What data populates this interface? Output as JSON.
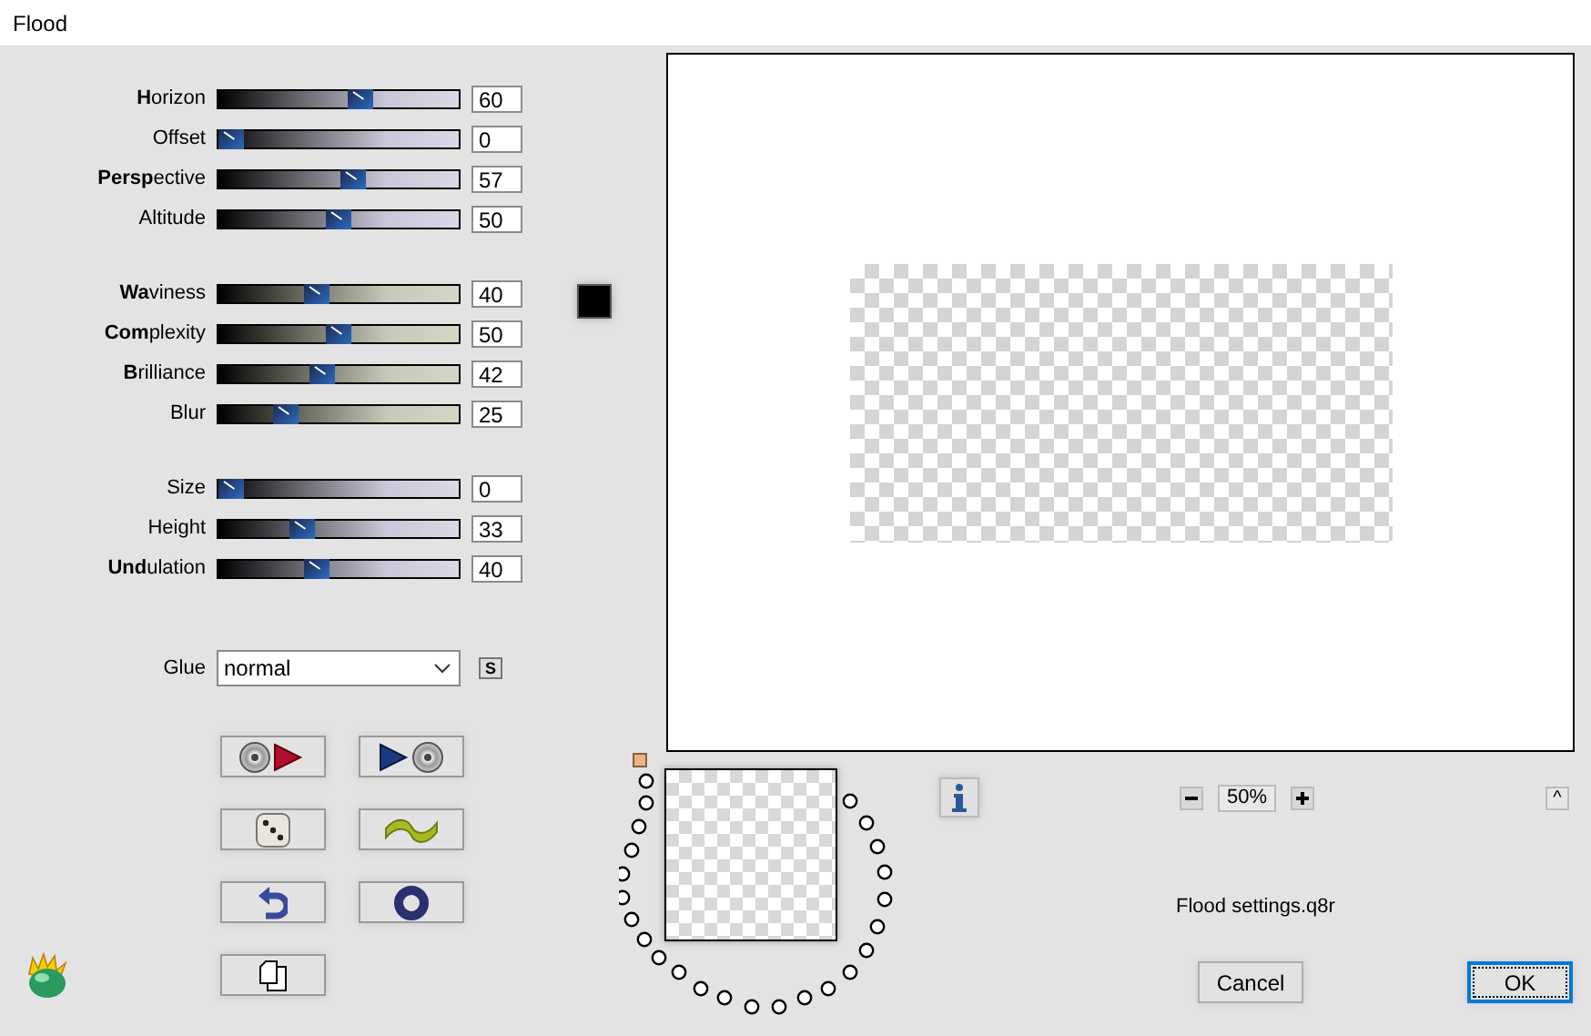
{
  "window": {
    "title": "Flood"
  },
  "slider_groups": [
    {
      "kind": "lavender",
      "rows": [
        {
          "label": "**H**orizon",
          "level": 0.6,
          "value": "60"
        },
        {
          "label": "Offset",
          "level": 0,
          "value": "0"
        },
        {
          "label": "**Persp**ective",
          "level": 0.57,
          "value": "57"
        },
        {
          "label": "Altitude",
          "level": 0.5,
          "value": "50"
        }
      ]
    },
    {
      "kind": "beige",
      "swatch": {
        "color": "#000000"
      },
      "rows": [
        {
          "label": "**Wa**viness",
          "level": 0.4,
          "value": "40"
        },
        {
          "label": "**Com**plexity",
          "level": 0.5,
          "value": "50"
        },
        {
          "label": "**B**rilliance",
          "level": 0.42,
          "value": "42"
        },
        {
          "label": "Blur",
          "level": 0.25,
          "value": "25"
        }
      ]
    },
    {
      "kind": "lavender",
      "rows": [
        {
          "label": "Size",
          "level": 0,
          "value": "0"
        },
        {
          "label": "Height",
          "level": 0.33,
          "value": "33"
        },
        {
          "label": "**Und**ulation",
          "level": 0.4,
          "value": "40"
        }
      ]
    }
  ],
  "glue": {
    "label": "Glue",
    "value": "normal",
    "side_button": "S"
  },
  "tool_buttons": [
    {
      "kind": "discplay"
    },
    {
      "kind": "playdisc"
    },
    {
      "kind": "dice"
    },
    {
      "kind": "wave"
    },
    {
      "kind": "undo"
    },
    {
      "kind": "ring"
    },
    {
      "kind": "pages"
    }
  ],
  "preview": {
    "zoom": "50%",
    "collapse": "^"
  },
  "file_name": "Flood settings.q8r",
  "buttons": [
    {
      "label": "Cancel",
      "default": false
    },
    {
      "label": "OK",
      "default": true
    }
  ]
}
